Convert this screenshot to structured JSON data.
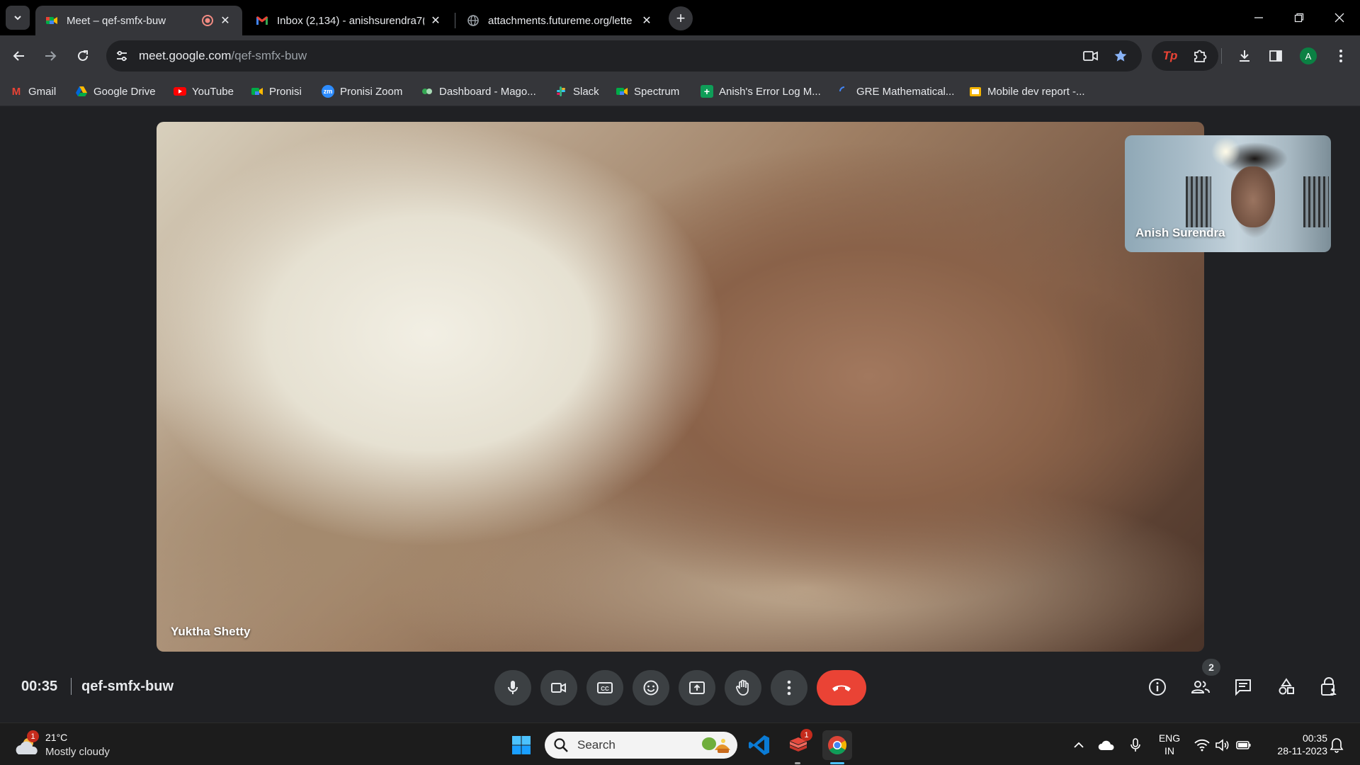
{
  "browser": {
    "tabs": [
      {
        "title": "Meet – qef-smfx-buw",
        "active": true,
        "recording": true
      },
      {
        "title": "Inbox (2,134) - anishsurendra7(",
        "active": false
      },
      {
        "title": "attachments.futureme.org/lette",
        "active": false
      }
    ],
    "address": {
      "host": "meet.google.com",
      "path": "/qef-smfx-buw"
    },
    "profile_initial": "A"
  },
  "bookmarks": [
    {
      "label": "Gmail",
      "icon": "gmail-icon",
      "color": "#ea4335"
    },
    {
      "label": "Google Drive",
      "icon": "drive-icon",
      "color": "#1fa463"
    },
    {
      "label": "YouTube",
      "icon": "youtube-icon",
      "color": "#ff0000"
    },
    {
      "label": "Pronisi",
      "icon": "meet-icon",
      "color": "#00832d"
    },
    {
      "label": "Pronisi Zoom",
      "icon": "zoom-icon",
      "color": "#2d8cff"
    },
    {
      "label": "Dashboard - Mago...",
      "icon": "dashboard-icon",
      "color": "#34a853"
    },
    {
      "label": "Slack",
      "icon": "slack-icon",
      "color": "#e01e5a"
    },
    {
      "label": "Spectrum",
      "icon": "meet-icon",
      "color": "#00832d"
    },
    {
      "label": "Anish's Error Log M...",
      "icon": "sheets-icon",
      "color": "#0f9d58"
    },
    {
      "label": "GRE Mathematical...",
      "icon": "loader-icon",
      "color": "#4285f4"
    },
    {
      "label": "Mobile dev report -...",
      "icon": "slides-icon",
      "color": "#f4b400"
    }
  ],
  "meet": {
    "main_participant": "Yuktha Shetty",
    "self_participant": "Anish Surendra",
    "elapsed": "00:35",
    "meeting_code": "qef-smfx-buw",
    "participant_count": "2",
    "end_color": "#ea4335"
  },
  "taskbar": {
    "weather_temp": "21°C",
    "weather_cond": "Mostly cloudy",
    "weather_badge": "1",
    "search_label": "Search",
    "store_badge": "1",
    "lang_line1": "ENG",
    "lang_line2": "IN",
    "time": "00:35",
    "date": "28-11-2023"
  }
}
